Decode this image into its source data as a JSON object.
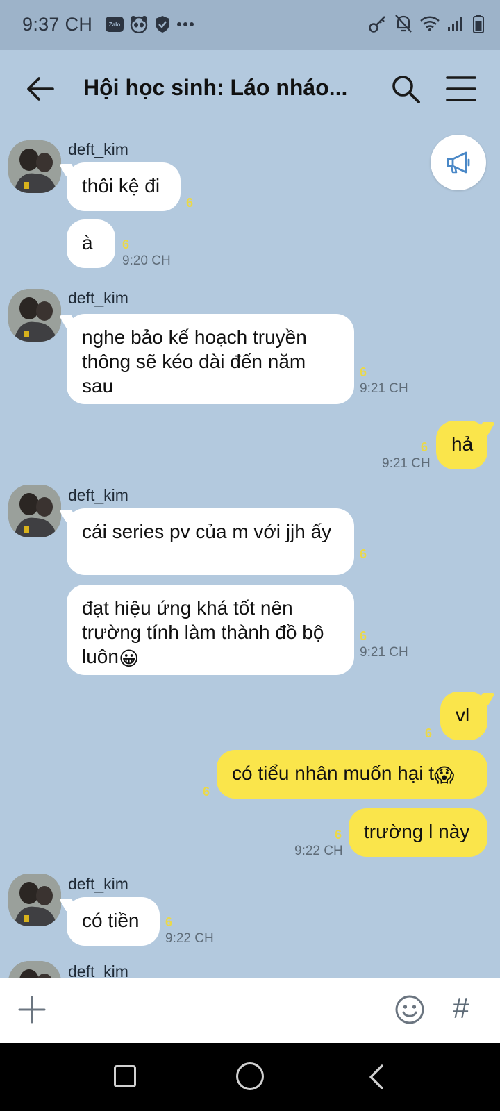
{
  "status_bar": {
    "time": "9:37 CH",
    "left_icons": [
      "zalo-icon",
      "panda-icon",
      "shield-icon",
      "more-dots-icon"
    ],
    "zalo_text": "Zalo",
    "right_icons": [
      "key-icon",
      "mute-icon",
      "wifi-icon",
      "signal-icon",
      "battery-icon"
    ]
  },
  "header": {
    "title": "Hội học sinh: Láo nháo..."
  },
  "colors": {
    "background": "#b3c9de",
    "incoming_bubble": "#ffffff",
    "outgoing_bubble": "#fae54b",
    "read_count": "#ead84a"
  },
  "messages": [
    {
      "sender": "deft_kim",
      "text": "thôi kệ đi",
      "read": "6",
      "direction": "in"
    },
    {
      "text": "à",
      "read": "6",
      "time": "9:20 CH",
      "direction": "in"
    },
    {
      "sender": "deft_kim",
      "text": "nghe bảo kế hoạch truyền thông sẽ kéo dài đến năm sau",
      "read": "6",
      "time": "9:21 CH",
      "direction": "in"
    },
    {
      "text": "hả",
      "read": "6",
      "time": "9:21 CH",
      "direction": "out"
    },
    {
      "sender": "deft_kim",
      "text": "cái series pv của m với jjh ấy",
      "read": "6",
      "direction": "in"
    },
    {
      "text": "đạt hiệu ứng khá tốt nên trường tính làm thành đồ bộ luôn",
      "emoji": "😀",
      "read": "6",
      "time": "9:21 CH",
      "direction": "in"
    },
    {
      "text": "vl",
      "read": "6",
      "direction": "out"
    },
    {
      "text": "có tiểu nhân muốn hại t",
      "emoji": "😱",
      "read": "6",
      "direction": "out"
    },
    {
      "text": "trường l này",
      "read": "6",
      "time": "9:22 CH",
      "direction": "out"
    },
    {
      "sender": "deft_kim",
      "text": "có tiền",
      "read": "6",
      "time": "9:22 CH",
      "direction": "in"
    },
    {
      "sender": "deft_kim",
      "direction": "in"
    }
  ]
}
